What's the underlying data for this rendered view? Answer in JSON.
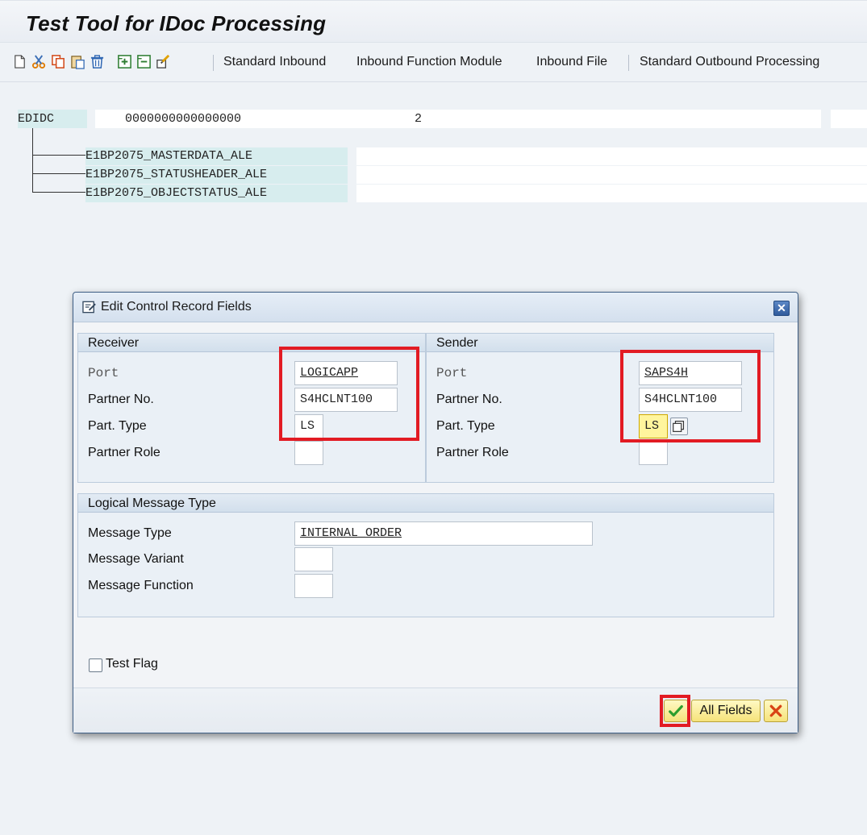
{
  "window": {
    "title": "Test Tool for IDoc Processing"
  },
  "toolbar": {
    "icons": [
      "new-document-icon",
      "cut-icon",
      "copy-icon",
      "paste-icon",
      "delete-icon",
      "expand-icon",
      "collapse-icon",
      "change-icon"
    ],
    "buttons": [
      {
        "label": "Standard Inbound"
      },
      {
        "label": "Inbound Function Module"
      },
      {
        "label": "Inbound File"
      },
      {
        "label": "Standard Outbound Processing"
      }
    ]
  },
  "tree": {
    "control_record": {
      "segment": "EDIDC",
      "number": "0000000000000000",
      "count": "2"
    },
    "segments": [
      {
        "name": "E1BP2075_MASTERDATA_ALE"
      },
      {
        "name": "E1BP2075_STATUSHEADER_ALE"
      },
      {
        "name": "E1BP2075_OBJECTSTATUS_ALE"
      }
    ]
  },
  "dialog": {
    "title": "Edit Control Record Fields",
    "receiver": {
      "header": "Receiver",
      "port_label": "Port",
      "port_value": "LOGICAPP",
      "partner_no_label": "Partner No.",
      "partner_no_value": "S4HCLNT100",
      "part_type_label": "Part. Type",
      "part_type_value": "LS",
      "partner_role_label": "Partner Role",
      "partner_role_value": ""
    },
    "sender": {
      "header": "Sender",
      "port_label": "Port",
      "port_value": "SAPS4H",
      "partner_no_label": "Partner No.",
      "partner_no_value": "S4HCLNT100",
      "part_type_label": "Part. Type",
      "part_type_value": "LS",
      "partner_role_label": "Partner Role",
      "partner_role_value": ""
    },
    "message": {
      "header": "Logical Message Type",
      "type_label": "Message Type",
      "type_value": "INTERNAL_ORDER",
      "variant_label": "Message Variant",
      "variant_value": "",
      "function_label": "Message Function",
      "function_value": ""
    },
    "test_flag_label": "Test Flag",
    "test_flag_checked": false,
    "buttons": {
      "confirm_icon": "checkmark-icon",
      "all_fields": "All Fields",
      "cancel_icon": "cancel-x-icon"
    }
  },
  "colors": {
    "highlight_box": "#e21b23",
    "segment_bg": "#d7edee",
    "active_field": "#fff59d"
  }
}
